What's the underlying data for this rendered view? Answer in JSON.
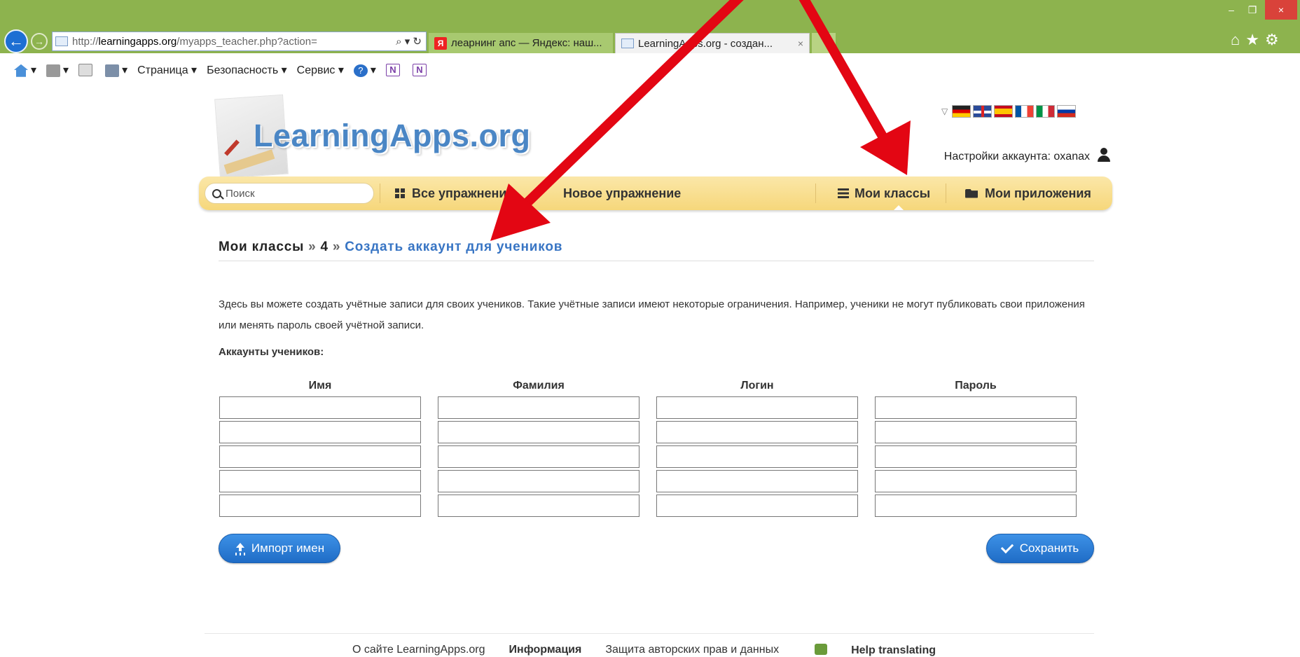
{
  "browser": {
    "url_prefix": "http://",
    "url_domain": "learningapps.org",
    "url_path": "/myapps_teacher.php?action=",
    "address_tools": "⌕ ▾ ↻",
    "tabs": [
      {
        "label": "леарнинг апс — Яндекс: наш...",
        "favicon": "Я"
      },
      {
        "label": "LearningApps.org - создан...",
        "close": "×"
      }
    ],
    "command_bar": {
      "page_menu": "Страница ▾",
      "security_menu": "Безопасность ▾",
      "service_menu": "Сервис ▾",
      "onenote_label": "N"
    },
    "window_controls": {
      "minimize": "–",
      "maximize": "❐",
      "close": "×"
    },
    "right_icons": "⌂★⚙"
  },
  "site": {
    "logo_text": "LearningApps.org",
    "flag_toggle": "▽",
    "account_label": "Настройки аккаунта: oxanax",
    "search": {
      "placeholder": "Поиск"
    },
    "menu": {
      "all_exercises": "Все упражнения",
      "new_exercise": "Новое упражнение",
      "my_classes": "Мои классы",
      "my_apps": "Мои приложения"
    }
  },
  "breadcrumb": {
    "root": "Мои классы",
    "sep": "»",
    "class": "4",
    "current": "Создать аккаунт для учеников"
  },
  "description": "Здесь вы можете создать учётные записи для своих учеников. Такие учётные записи имеют некоторые ограничения. Например, ученики не могут публиковать свои приложения или менять пароль своей учётной записи.",
  "accounts_label": "Аккаунты учеников:",
  "columns": {
    "first_name": "Имя",
    "last_name": "Фамилия",
    "login": "Логин",
    "password": "Пароль"
  },
  "rows_count": 5,
  "buttons": {
    "import": "Импорт имен",
    "save": "Сохранить"
  },
  "footer": {
    "about": "О сайте LearningApps.org",
    "info": "Информация",
    "copyright": "Защита авторских прав и данных",
    "help": "Help translating"
  },
  "colors": {
    "chrome_green": "#8db34e",
    "menu_yellow": "#f6d77b",
    "link_blue": "#3875c4",
    "button_blue": "#1f6cc6",
    "arrow_red": "#e30613"
  }
}
